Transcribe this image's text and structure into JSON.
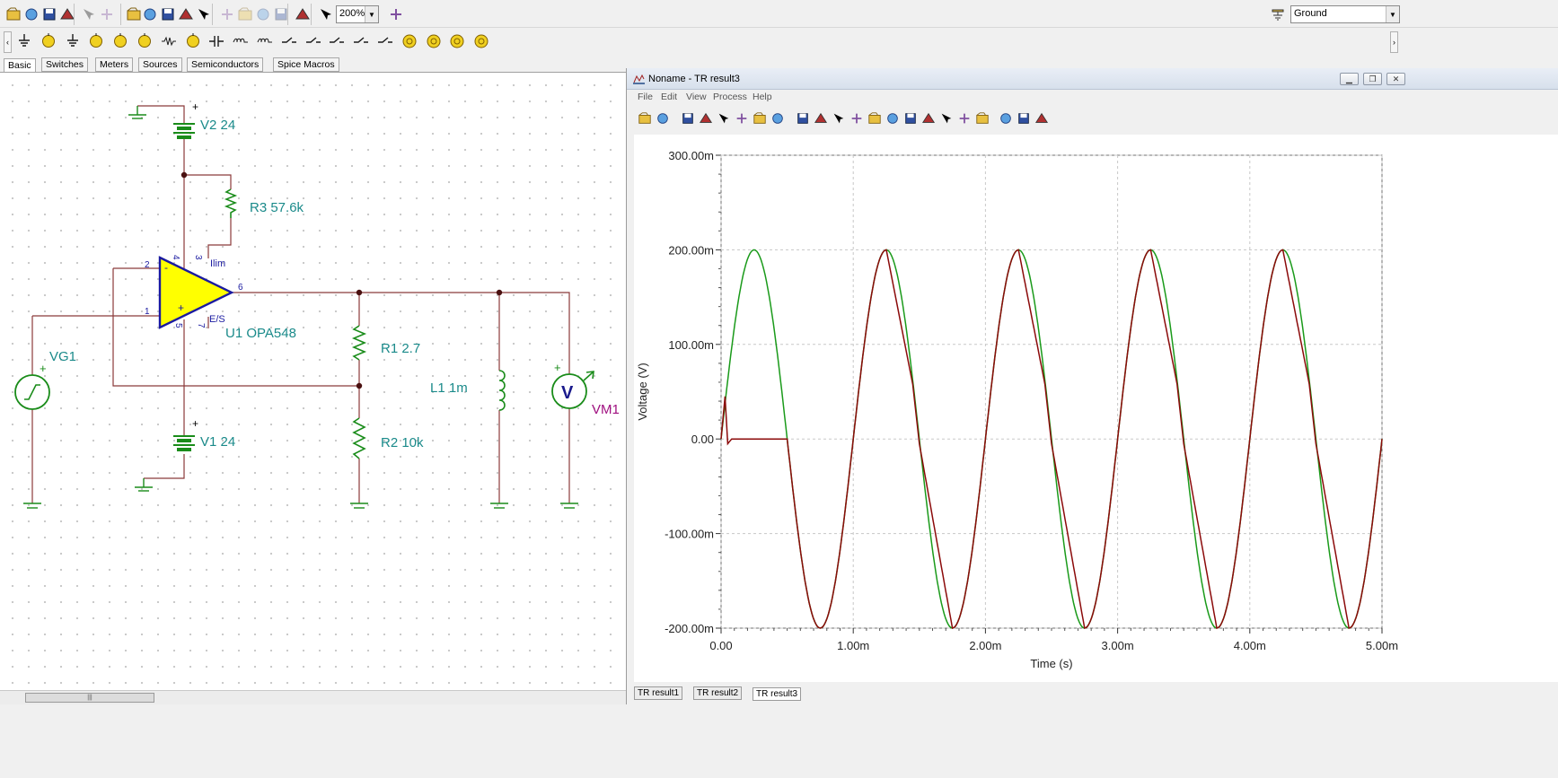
{
  "toolbar": {
    "zoom_value": "200%",
    "ground_combo": "Ground",
    "buttons": [
      "open-icon",
      "browse-icon",
      "save-icon",
      "save-as-icon",
      "copy-icon",
      "paste-icon",
      "select-arrow-icon",
      "wire-tool-icon",
      "pencil-icon",
      "text-tool-icon",
      "rotate-text-icon",
      "delete-icon",
      "undo-icon",
      "redo-icon",
      "move-icon",
      "grid-icon",
      "zoom-icon",
      "dc-analysis-icon"
    ]
  },
  "components_bar": {
    "items": [
      "ground-icon",
      "voltage-pin-icon",
      "battery-icon",
      "current-pin-icon",
      "voltmeter-icon",
      "ammeter-icon",
      "resistor-icon",
      "potentiometer-icon",
      "capacitor-icon",
      "inductor-icon",
      "transformer-icon",
      "switch-icon",
      "relay-icon",
      "switch-spdt-icon",
      "zener-icon",
      "probe-icon",
      "lamp-icon",
      "lamp-ic-icon",
      "lamp-ib-icon",
      "lamp-ic2-icon"
    ],
    "tabs": [
      "Basic",
      "Switches",
      "Meters",
      "Sources",
      "Semiconductors",
      "Spice Macros"
    ],
    "active_tab": "Basic"
  },
  "schematic": {
    "labels": {
      "v2": "V2 24",
      "v1": "V1 24",
      "r3": "R3 57.6k",
      "r1": "R1 2.7",
      "r2": "R2 10k",
      "l1": "L1 1m",
      "u1": "U1 OPA548",
      "vg1": "VG1",
      "vm1": "VM1",
      "ilim": "Ilim",
      "es": "E/S",
      "pin1": "1",
      "pin2": "2",
      "pin3": "3",
      "pin4": "4",
      "pin5": "5",
      "pin6": "6",
      "pin7": "7",
      "plus": "+",
      "minus": "-",
      "voltmeter_letter": "V"
    },
    "colors": {
      "component": "#1a8c1a",
      "label": "#1a8a8a",
      "wire": "#8b3a3a",
      "opamp_fill": "#ffff00",
      "opamp_edge": "#1a1aa0",
      "vm1": "#a01080",
      "pin": "#1a1aa0"
    }
  },
  "result_window": {
    "title": "Noname - TR result3",
    "menu": [
      "File",
      "Edit",
      "View",
      "Process",
      "Help"
    ],
    "tabs": [
      "TR result1",
      "TR result2",
      "TR result3"
    ],
    "active_tab": "TR result3",
    "tool_icons": [
      "open-icon",
      "save-icon",
      "copy-icon",
      "paste-icon",
      "select-arrow-icon",
      "zoom-in-icon",
      "zoom-out-icon",
      "grid-icon",
      "text-tool-icon",
      "cursor-a-icon",
      "cursor-b-icon",
      "curve-icon",
      "line-icon",
      "circle-icon",
      "marker-icon",
      "cursor-cross-icon",
      "waveform-icon",
      "pen-icon",
      "corner-icon",
      "arrow-left-icon",
      "arrow-updown-icon",
      "arrow-right-icon"
    ]
  },
  "chart_data": {
    "type": "line",
    "xlabel": "Time (s)",
    "ylabel": "Voltage (V)",
    "xlim": [
      0,
      5.0
    ],
    "ylim": [
      -200,
      300
    ],
    "x_unit_scale": "ms",
    "y_unit_scale": "mV",
    "xticks": [
      "0.00",
      "1.00m",
      "2.00m",
      "3.00m",
      "4.00m",
      "5.00m"
    ],
    "yticks": [
      "300.00m",
      "200.00m",
      "100.00m",
      "0.00",
      "-100.00m",
      "-200.00m"
    ],
    "grid": true,
    "series": [
      {
        "color": "#1a9a1a",
        "x": [
          0,
          0.25,
          0.5,
          0.75,
          1.0,
          1.25,
          1.5,
          1.75,
          2.0,
          2.25,
          2.5,
          2.75,
          3.0,
          3.25,
          3.5,
          3.75,
          4.0,
          4.25,
          4.5,
          4.75,
          5.0
        ],
        "values": [
          0,
          200,
          0,
          -200,
          0,
          200,
          0,
          -200,
          0,
          200,
          0,
          -200,
          0,
          200,
          0,
          -200,
          0,
          200,
          0,
          -200,
          0
        ]
      },
      {
        "color": "#8b0a0a",
        "x": [
          0,
          0.03,
          0.05,
          0.08,
          0.5,
          0.75,
          1.0,
          1.25,
          1.45,
          1.5,
          1.75,
          2.0,
          2.25,
          2.45,
          2.5,
          2.75,
          3.0,
          3.25,
          3.45,
          3.5,
          3.75,
          4.0,
          4.25,
          4.45,
          4.5,
          4.75,
          5.0
        ],
        "values": [
          0,
          45,
          -5,
          0,
          0,
          -200,
          0,
          200,
          58,
          -5,
          -200,
          0,
          200,
          58,
          -5,
          -200,
          0,
          200,
          58,
          -5,
          -200,
          0,
          200,
          58,
          -5,
          -200,
          0
        ]
      }
    ]
  }
}
